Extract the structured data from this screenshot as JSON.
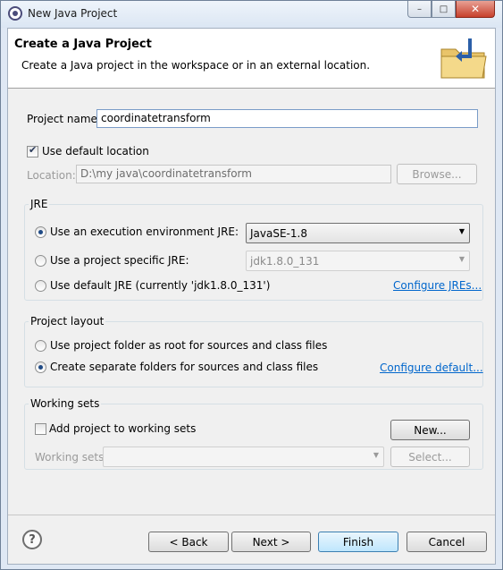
{
  "window": {
    "title": "New Java Project",
    "minimize_glyph": "–",
    "maximize_glyph": "□",
    "close_glyph": "✕"
  },
  "banner": {
    "title": "Create a Java Project",
    "description": "Create a Java project in the workspace or in an external location.",
    "icon": "folder-wizard-icon"
  },
  "project": {
    "name_label": "Project name:",
    "name_value": "coordinatetransform",
    "use_default_location_label": "Use default location",
    "use_default_location_checked": true,
    "location_label": "Location:",
    "location_value": "D:\\my java\\coordinatetransform",
    "browse_label": "Browse..."
  },
  "jre": {
    "group_title": "JRE",
    "option_env_label": "Use an execution environment JRE:",
    "option_env_value": "JavaSE-1.8",
    "option_specific_label": "Use a project specific JRE:",
    "option_specific_value": "jdk1.8.0_131",
    "option_default_label": "Use default JRE (currently 'jdk1.8.0_131')",
    "configure_link": "Configure JREs...",
    "selected": "env"
  },
  "layout": {
    "group_title": "Project layout",
    "option_root_label": "Use project folder as root for sources and class files",
    "option_separate_label": "Create separate folders for sources and class files",
    "configure_link": "Configure default...",
    "selected": "separate"
  },
  "working_sets": {
    "group_title": "Working sets",
    "add_label": "Add project to working sets",
    "add_checked": false,
    "new_button": "New...",
    "sets_label": "Working sets:",
    "sets_value": "",
    "select_button": "Select..."
  },
  "footer": {
    "help_glyph": "?",
    "back_label": "< Back",
    "next_label": "Next >",
    "finish_label": "Finish",
    "cancel_label": "Cancel"
  },
  "colors": {
    "link": "#0066cc",
    "finish_border": "#3c7fb1"
  }
}
